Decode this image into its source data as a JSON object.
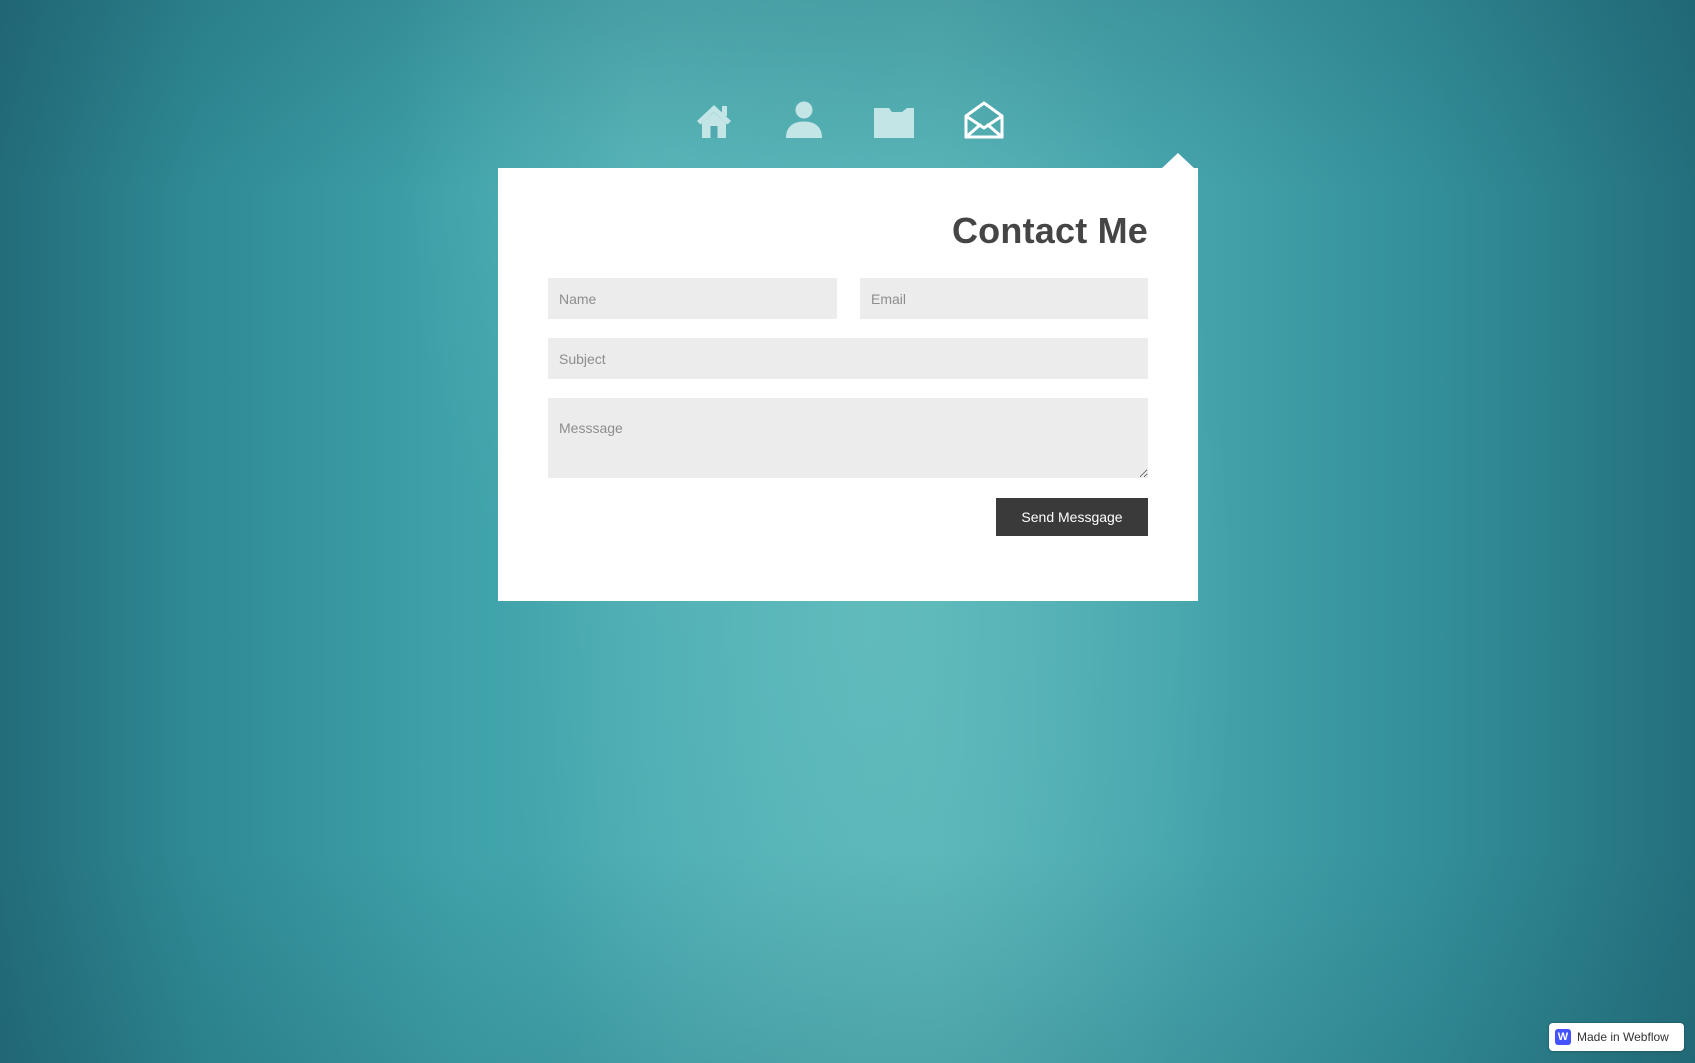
{
  "nav": {
    "items": [
      {
        "name": "home",
        "icon": "home-icon",
        "active": false
      },
      {
        "name": "about",
        "icon": "user-icon",
        "active": false
      },
      {
        "name": "work",
        "icon": "folder-icon",
        "active": false
      },
      {
        "name": "contact",
        "icon": "envelope-open-icon",
        "active": true
      }
    ],
    "icon_color": "#c4e5e6",
    "active_icon_color": "#ffffff"
  },
  "contact": {
    "title": "Contact Me",
    "name_placeholder": "Name",
    "email_placeholder": "Email",
    "subject_placeholder": "Subject",
    "message_placeholder": "Messsage",
    "send_label": "Send Messgage"
  },
  "badge": {
    "logo_letter": "W",
    "label": "Made in Webflow"
  },
  "colors": {
    "background_teal": "#45a4ac",
    "panel": "#ffffff",
    "field_bg": "#ececec",
    "button_bg": "#3a3a3a",
    "title_color": "#454545",
    "webflow_blue": "#4353ff"
  }
}
